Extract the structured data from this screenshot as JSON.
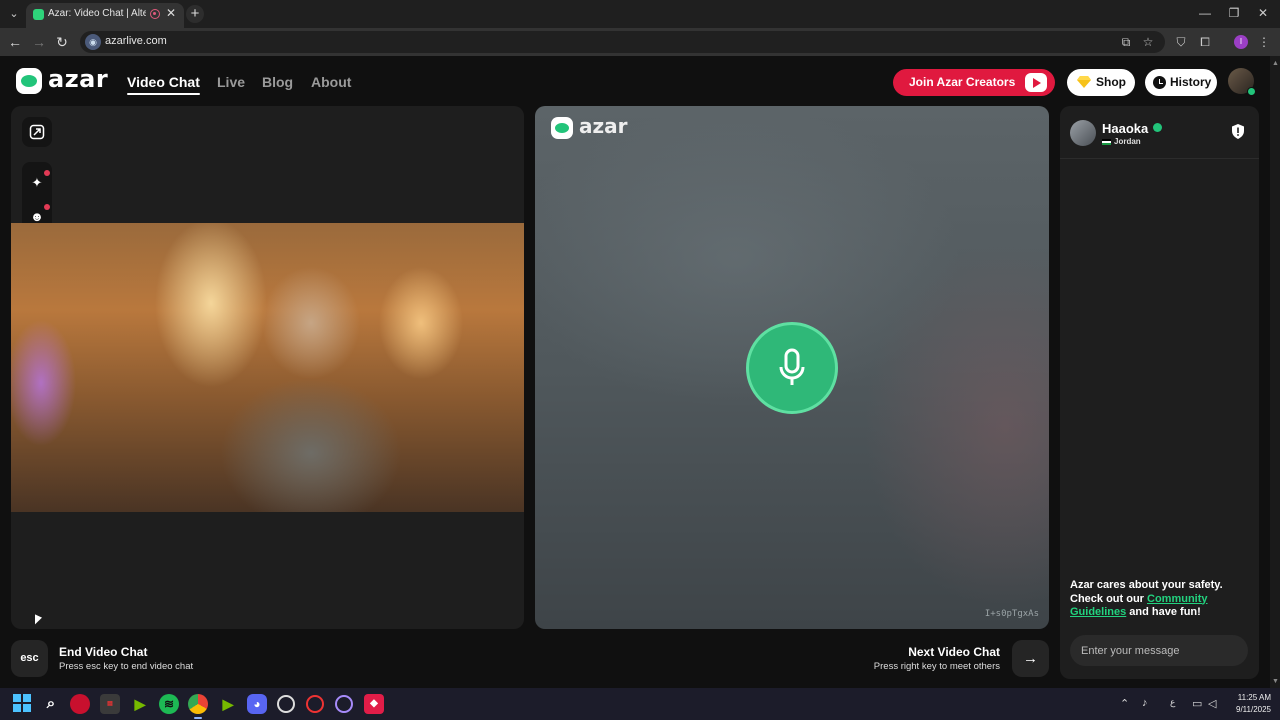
{
  "browser": {
    "tab_title": "Azar: Video Chat | Alternative",
    "url": "azarlive.com",
    "profile_initial": "I"
  },
  "header": {
    "logo_text": "azar",
    "nav": [
      {
        "label": "Video Chat",
        "active": true
      },
      {
        "label": "Live",
        "active": false
      },
      {
        "label": "Blog",
        "active": false
      },
      {
        "label": "About",
        "active": false
      }
    ],
    "join_creators": "Join Azar Creators",
    "shop": "Shop",
    "history": "History"
  },
  "partner_video": {
    "logo_text": "azar",
    "watermark": "I+s0pTgxAs"
  },
  "chat": {
    "peer_name": "Haaoka",
    "peer_country": "Jordan",
    "safety_text_1": "Azar cares about your safety. Check out our ",
    "safety_link": "Community Guidelines",
    "safety_text_2": " and have fun!",
    "message_placeholder": "Enter your message"
  },
  "controls": {
    "esc_key": "esc",
    "end_title": "End Video Chat",
    "end_sub": "Press esc key to end video chat",
    "next_title": "Next Video Chat",
    "next_sub": "Press right key to meet others"
  },
  "taskbar": {
    "time": "11:25 AM",
    "date": "9/11/2025",
    "lang": "ع",
    "apps": [
      "windows-start",
      "search",
      "app-red",
      "steam-writer",
      "nvidia",
      "spotify",
      "chrome",
      "nvidia-2",
      "discord",
      "app-clock",
      "app-red-2",
      "app-purple",
      "app-red-3"
    ]
  },
  "colors": {
    "accent_green": "#22c47a",
    "creators_red": "#e0193f",
    "background": "#101010",
    "panel": "#1e1e1e"
  }
}
